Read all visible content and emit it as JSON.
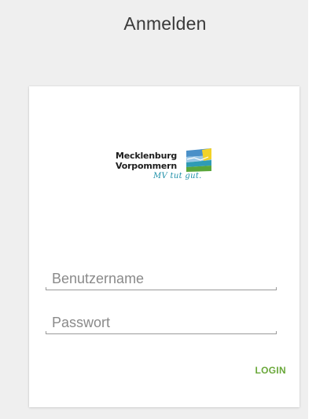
{
  "header": {
    "title": "Anmelden"
  },
  "logo": {
    "line1": "Mecklenburg",
    "line2": "Vorpommern",
    "slogan": "MV tut gut."
  },
  "form": {
    "username_placeholder": "Benutzername",
    "username_value": "",
    "password_placeholder": "Passwort",
    "password_value": "",
    "login_label": "LOGIN"
  },
  "colors": {
    "page_background": "#efefef",
    "card_background": "#ffffff",
    "accent_login": "#6aa83a",
    "slogan": "#1d8fa8"
  }
}
